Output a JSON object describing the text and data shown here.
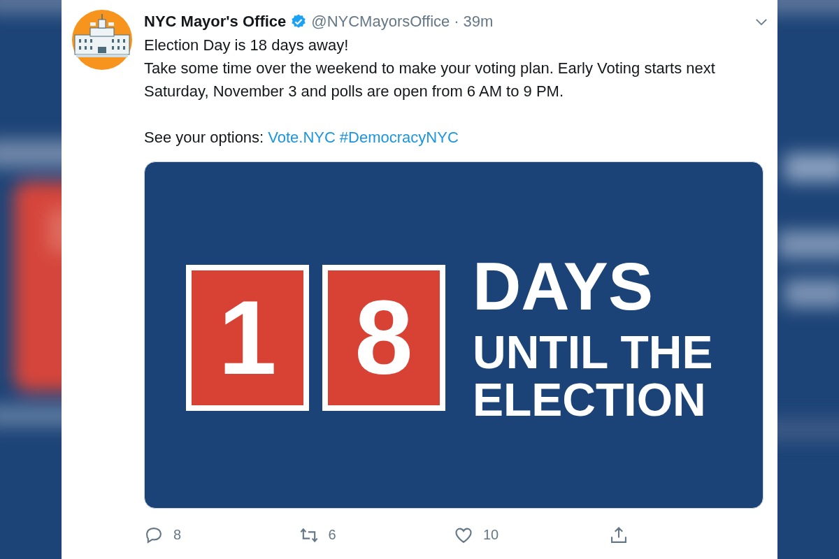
{
  "tweet": {
    "author": {
      "name": "NYC Mayor's Office",
      "verified": true,
      "handle": "@NYCMayorsOffice",
      "separator": "·",
      "time": "39m"
    },
    "paragraphs": [
      "Election Day is 18 days away!",
      "Take some time over the weekend to make your voting plan. Early Voting starts next Saturday, November 3 and polls are open from 6 AM to 9 PM."
    ],
    "options": {
      "text": "See your options:",
      "links": [
        "Vote.NYC",
        "#DemocracyNYC"
      ]
    },
    "media": {
      "digits": [
        "1",
        "8"
      ],
      "headline": "DAYS",
      "subline": [
        "UNTIL THE",
        "ELECTION"
      ]
    },
    "actions": [
      {
        "kind": "reply",
        "count": "8"
      },
      {
        "kind": "retweet",
        "count": "6"
      },
      {
        "kind": "like",
        "count": "10"
      },
      {
        "kind": "share"
      }
    ]
  }
}
